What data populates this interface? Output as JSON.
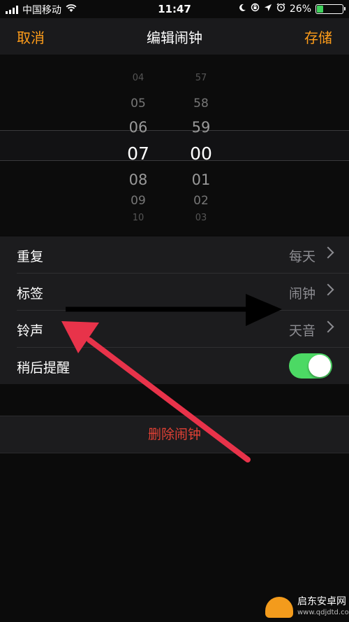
{
  "status_bar": {
    "carrier": "中国移动",
    "time": "11:47",
    "battery_percent": "26%",
    "battery_level": 0.26,
    "icons": [
      "signal-icon",
      "wifi-icon",
      "moon-icon",
      "lock-rotation-icon",
      "location-icon",
      "alarm-icon",
      "battery-icon"
    ]
  },
  "nav": {
    "cancel": "取消",
    "title": "编辑闹钟",
    "save": "存储",
    "accent_color": "#ff9d1a"
  },
  "picker": {
    "hours": [
      "04",
      "05",
      "06",
      "07",
      "08",
      "09",
      "10"
    ],
    "minutes": [
      "57",
      "58",
      "59",
      "00",
      "01",
      "02",
      "03"
    ],
    "selected_hour": "07",
    "selected_minute": "00"
  },
  "settings": {
    "repeat": {
      "label": "重复",
      "value": "每天"
    },
    "label": {
      "label": "标签",
      "value": "闹钟"
    },
    "sound": {
      "label": "铃声",
      "value": "天音"
    },
    "snooze": {
      "label": "稍后提醒",
      "on": true
    }
  },
  "delete_label": "删除闹钟",
  "annotations": {
    "arrow_colors": [
      "#000000",
      "#e8334a"
    ]
  },
  "watermark": {
    "brand": "启东安卓网",
    "url": "www.qdjdtd.com"
  }
}
